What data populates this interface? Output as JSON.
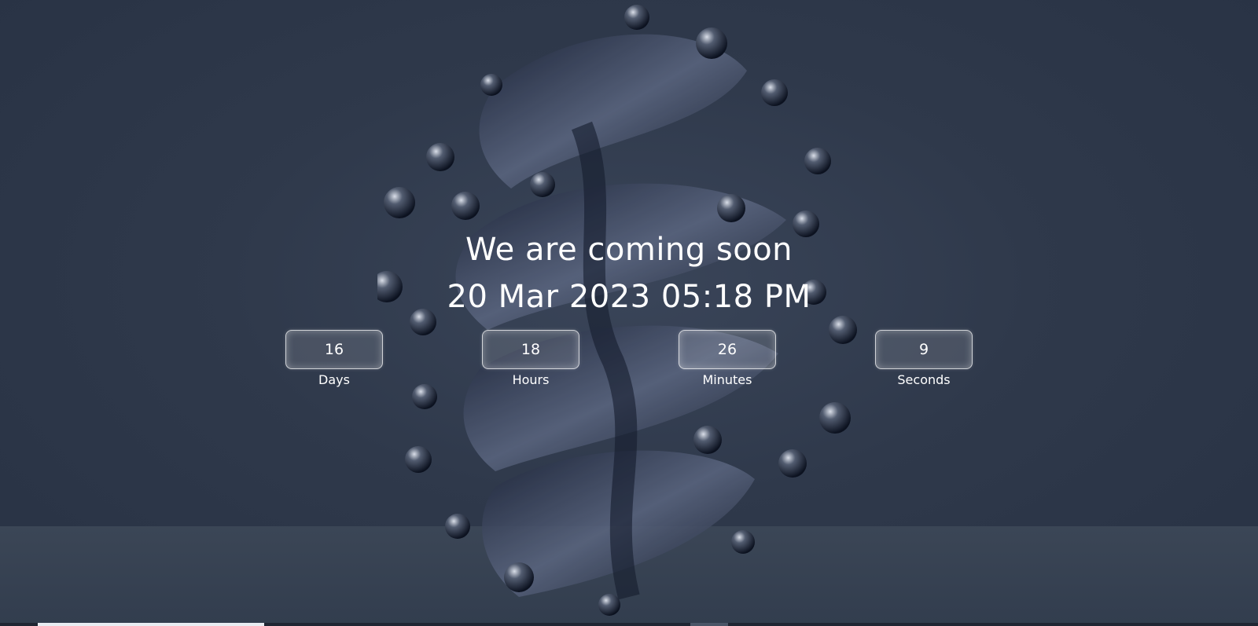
{
  "hero": {
    "headline": "We are coming soon",
    "launch_datetime": "20 Mar 2023 05:18 PM"
  },
  "countdown": [
    {
      "value": "16",
      "label": "Days"
    },
    {
      "value": "18",
      "label": "Hours"
    },
    {
      "value": "26",
      "label": "Minutes"
    },
    {
      "value": "9",
      "label": "Seconds"
    }
  ],
  "colors": {
    "background": "#2f394b",
    "text": "#ffffff",
    "box_border": "#ffffff"
  }
}
